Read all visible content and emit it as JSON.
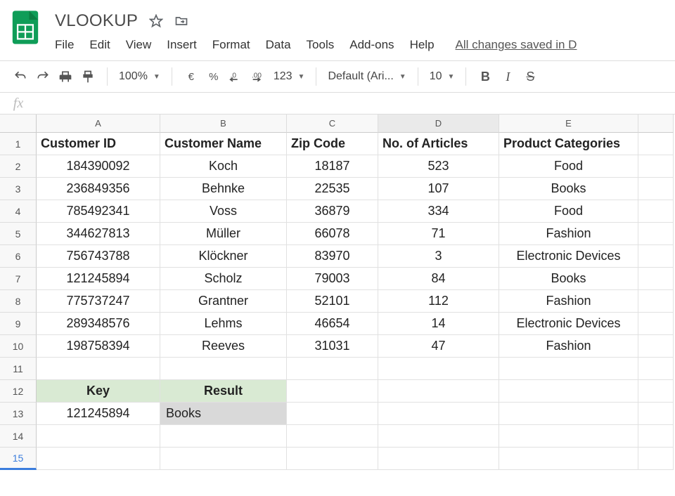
{
  "doc": {
    "title": "VLOOKUP",
    "save_status": "All changes saved in D"
  },
  "menus": {
    "file": "File",
    "edit": "Edit",
    "view": "View",
    "insert": "Insert",
    "format": "Format",
    "data": "Data",
    "tools": "Tools",
    "addons": "Add-ons",
    "help": "Help"
  },
  "toolbar": {
    "zoom": "100%",
    "currency": "€",
    "percent": "%",
    "dec_dec": ".0",
    "inc_dec": ".00",
    "more_fmt": "123",
    "font": "Default (Ari...",
    "size": "10",
    "bold": "B",
    "italic": "I",
    "strike": "S"
  },
  "columns": [
    "A",
    "B",
    "C",
    "D",
    "E"
  ],
  "headers": {
    "A": "Customer ID",
    "B": "Customer Name",
    "C": "Zip Code",
    "D": "No. of Articles",
    "E": "Product Categories"
  },
  "rows": [
    {
      "A": "184390092",
      "B": "Koch",
      "C": "18187",
      "D": "523",
      "E": "Food"
    },
    {
      "A": "236849356",
      "B": "Behnke",
      "C": "22535",
      "D": "107",
      "E": "Books"
    },
    {
      "A": "785492341",
      "B": "Voss",
      "C": "36879",
      "D": "334",
      "E": "Food"
    },
    {
      "A": "344627813",
      "B": "Müller",
      "C": "66078",
      "D": "71",
      "E": "Fashion"
    },
    {
      "A": "756743788",
      "B": "Klöckner",
      "C": "83970",
      "D": "3",
      "E": "Electronic Devices"
    },
    {
      "A": "121245894",
      "B": "Scholz",
      "C": "79003",
      "D": "84",
      "E": "Books"
    },
    {
      "A": "775737247",
      "B": "Grantner",
      "C": "52101",
      "D": "112",
      "E": "Fashion"
    },
    {
      "A": "289348576",
      "B": "Lehms",
      "C": "46654",
      "D": "14",
      "E": "Electronic Devices"
    },
    {
      "A": "198758394",
      "B": "Reeves",
      "C": "31031",
      "D": "47",
      "E": "Fashion"
    }
  ],
  "lookup": {
    "key_label": "Key",
    "result_label": "Result",
    "key": "121245894",
    "result": "Books"
  }
}
